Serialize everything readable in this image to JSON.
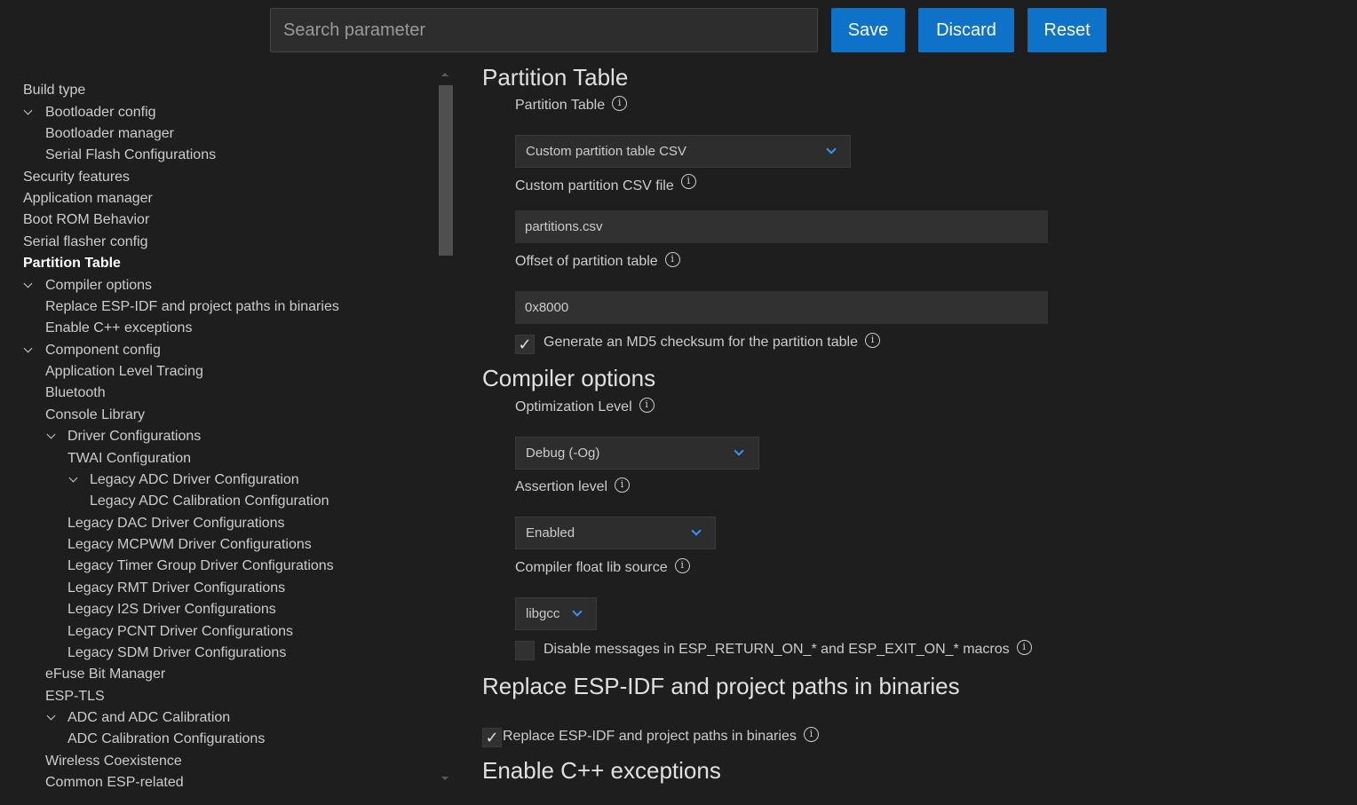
{
  "toolbar": {
    "search_placeholder": "Search parameter",
    "save_label": "Save",
    "discard_label": "Discard",
    "reset_label": "Reset"
  },
  "sidebar": {
    "items": [
      {
        "label": "Build type",
        "expanded": null,
        "active": false
      },
      {
        "label": "Bootloader config",
        "expanded": true,
        "active": false
      },
      {
        "label": "Bootloader manager",
        "expanded": null,
        "active": false
      },
      {
        "label": "Serial Flash Configurations",
        "expanded": null,
        "active": false
      },
      {
        "label": "Security features",
        "expanded": null,
        "active": false
      },
      {
        "label": "Application manager",
        "expanded": null,
        "active": false
      },
      {
        "label": "Boot ROM Behavior",
        "expanded": null,
        "active": false
      },
      {
        "label": "Serial flasher config",
        "expanded": null,
        "active": false
      },
      {
        "label": "Partition Table",
        "expanded": null,
        "active": true
      },
      {
        "label": "Compiler options",
        "expanded": true,
        "active": false
      },
      {
        "label": "Replace ESP-IDF and project paths in binaries",
        "expanded": null,
        "active": false
      },
      {
        "label": "Enable C++ exceptions",
        "expanded": null,
        "active": false
      },
      {
        "label": "Component config",
        "expanded": true,
        "active": false
      },
      {
        "label": "Application Level Tracing",
        "expanded": null,
        "active": false
      },
      {
        "label": "Bluetooth",
        "expanded": null,
        "active": false
      },
      {
        "label": "Console Library",
        "expanded": null,
        "active": false
      },
      {
        "label": "Driver Configurations",
        "expanded": true,
        "active": false
      },
      {
        "label": "TWAI Configuration",
        "expanded": null,
        "active": false
      },
      {
        "label": "Legacy ADC Driver Configuration",
        "expanded": true,
        "active": false
      },
      {
        "label": "Legacy ADC Calibration Configuration",
        "expanded": null,
        "active": false
      },
      {
        "label": "Legacy DAC Driver Configurations",
        "expanded": null,
        "active": false
      },
      {
        "label": "Legacy MCPWM Driver Configurations",
        "expanded": null,
        "active": false
      },
      {
        "label": "Legacy Timer Group Driver Configurations",
        "expanded": null,
        "active": false
      },
      {
        "label": "Legacy RMT Driver Configurations",
        "expanded": null,
        "active": false
      },
      {
        "label": "Legacy I2S Driver Configurations",
        "expanded": null,
        "active": false
      },
      {
        "label": "Legacy PCNT Driver Configurations",
        "expanded": null,
        "active": false
      },
      {
        "label": "Legacy SDM Driver Configurations",
        "expanded": null,
        "active": false
      },
      {
        "label": "eFuse Bit Manager",
        "expanded": null,
        "active": false
      },
      {
        "label": "ESP-TLS",
        "expanded": null,
        "active": false
      },
      {
        "label": "ADC and ADC Calibration",
        "expanded": true,
        "active": false
      },
      {
        "label": "ADC Calibration Configurations",
        "expanded": null,
        "active": false
      },
      {
        "label": "Wireless Coexistence",
        "expanded": null,
        "active": false
      },
      {
        "label": "Common ESP-related",
        "expanded": null,
        "active": false
      }
    ]
  },
  "content": {
    "partition_table": {
      "title": "Partition Table",
      "type_label": "Partition Table",
      "type_value": "Custom partition table CSV",
      "csv_label": "Custom partition CSV file",
      "csv_value": "partitions.csv",
      "offset_label": "Offset of partition table",
      "offset_value": "0x8000",
      "md5_label": "Generate an MD5 checksum for the partition table",
      "md5_checked": true
    },
    "compiler_options": {
      "title": "Compiler options",
      "opt_label": "Optimization Level",
      "opt_value": "Debug (-Og)",
      "assert_label": "Assertion level",
      "assert_value": "Enabled",
      "float_label": "Compiler float lib source",
      "float_value": "libgcc",
      "disable_msgs_label": "Disable messages in ESP_RETURN_ON_* and ESP_EXIT_ON_* macros",
      "disable_msgs_checked": false
    },
    "replace_paths": {
      "title": "Replace ESP-IDF and project paths in binaries",
      "check_label": "Replace ESP-IDF and project paths in binaries",
      "checked": true
    },
    "cpp_exceptions": {
      "title": "Enable C++ exceptions"
    },
    "checkmark": "✓",
    "info_glyph": "i"
  }
}
